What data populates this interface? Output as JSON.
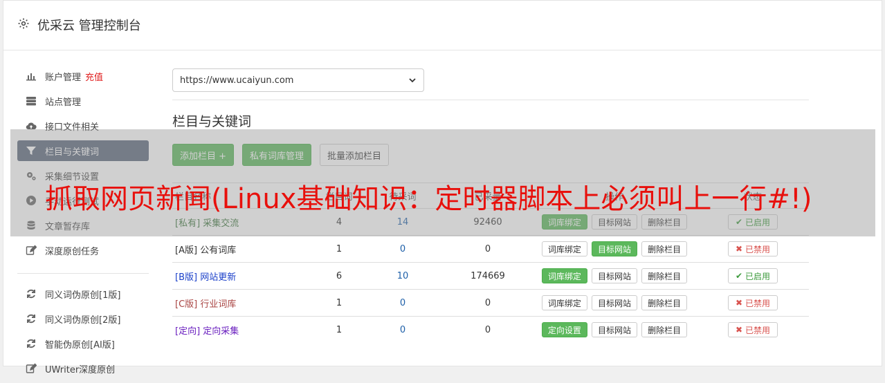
{
  "header": {
    "title": "优采云 管理控制台"
  },
  "sidebar": {
    "items": [
      {
        "label": "账户管理",
        "extra": "充值",
        "icon": "bar-chart-icon"
      },
      {
        "label": "站点管理",
        "icon": "server-icon"
      },
      {
        "label": "接口文件相关",
        "icon": "cloud-upload-icon"
      },
      {
        "label": "栏目与关键词",
        "icon": "filter-icon",
        "active": true
      },
      {
        "label": "采集细节设置",
        "icon": "cogs-icon"
      },
      {
        "label": "手动运行测试",
        "icon": "play-circle-icon"
      },
      {
        "label": "文章暂存库",
        "icon": "database-icon"
      },
      {
        "label": "深度原创任务",
        "icon": "edit-icon"
      }
    ],
    "items2": [
      {
        "label": "同义词伪原创[1版]",
        "icon": "refresh-icon"
      },
      {
        "label": "同义词伪原创[2版]",
        "icon": "refresh-icon"
      },
      {
        "label": "智能伪原创[AI版]",
        "icon": "refresh-icon"
      },
      {
        "label": "UWriter深度原创",
        "icon": "edit-icon"
      }
    ]
  },
  "main": {
    "site_select": "https://www.ucaiyun.com",
    "section_title": "栏目与关键词",
    "buttons": {
      "add": "添加栏目 +",
      "private_lib": "私有词库管理",
      "batch_add": "批量添加栏目"
    },
    "table": {
      "headers": [
        "栏目名称",
        "栏目词",
        "待采词",
        "已采量",
        "操作",
        "状态"
      ],
      "rows": [
        {
          "tag": "[私有]",
          "name": "采集交流",
          "c1": "4",
          "c2": "14",
          "c3": "92460",
          "b1": "词库绑定",
          "b2": "目标网站",
          "b3": "删除栏目",
          "status": "已启用"
        },
        {
          "tag": "[A版]",
          "name": "公有词库",
          "c1": "1",
          "c2": "0",
          "c3": "0",
          "b1": "词库绑定",
          "b2": "目标网站",
          "b3": "删除栏目",
          "status": "已禁用"
        },
        {
          "tag": "[B版]",
          "name": "网站更新",
          "c1": "6",
          "c2": "10",
          "c3": "174669",
          "b1": "词库绑定",
          "b2": "目标网站",
          "b3": "删除栏目",
          "status": "已启用"
        },
        {
          "tag": "[C版]",
          "name": "行业词库",
          "c1": "1",
          "c2": "0",
          "c3": "0",
          "b1": "词库绑定",
          "b2": "目标网站",
          "b3": "删除栏目",
          "status": "已禁用"
        },
        {
          "tag": "[定向]",
          "name": "定向采集",
          "c1": "1",
          "c2": "0",
          "c3": "0",
          "b1": "定向设置",
          "b2": "目标网站",
          "b3": "删除栏目",
          "status": "已禁用"
        }
      ]
    }
  },
  "overlay": {
    "headline": "抓取网页新闻(Linux基础知识：定时器脚本上必须叫上一行#!)"
  },
  "colors": {
    "accent_green": "#5cb85c",
    "sidebar_active": "#59667a",
    "headline_red": "#e8100c"
  }
}
